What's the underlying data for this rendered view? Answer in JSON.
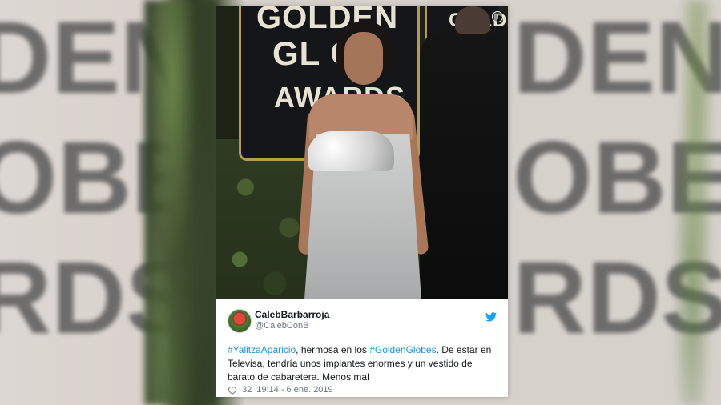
{
  "background": {
    "left_text": "DEN\nOBE\nRDS",
    "right_text": "DEN\nOBE\nRDS"
  },
  "photo": {
    "backdrop_line1": "GOLDEN",
    "backdrop_line2": "GL  O",
    "backdrop_line3": "AWARDS",
    "backdrop_right": "GOLD",
    "info_icon": "i"
  },
  "tweet": {
    "display_name": "CalebBarbarroja",
    "handle": "@CalebConB",
    "hashtag1": "#YalitzaAparicio",
    "text_part1": ", hermosa en los ",
    "hashtag2": "#GoldenGlobes",
    "text_part2": ". De estar en Televisa, tendría unos implantes enormes y un vestido de barato de cabaretera. Menos mal",
    "likes": "32",
    "timestamp": "19:14 - 6 ene. 2019",
    "icons": {
      "avatar": "avatar",
      "bird": "twitter-bird-icon",
      "heart": "heart-icon",
      "info": "info-icon"
    },
    "colors": {
      "link": "#1b95e0",
      "text": "#14171a",
      "secondary": "#657786"
    }
  }
}
